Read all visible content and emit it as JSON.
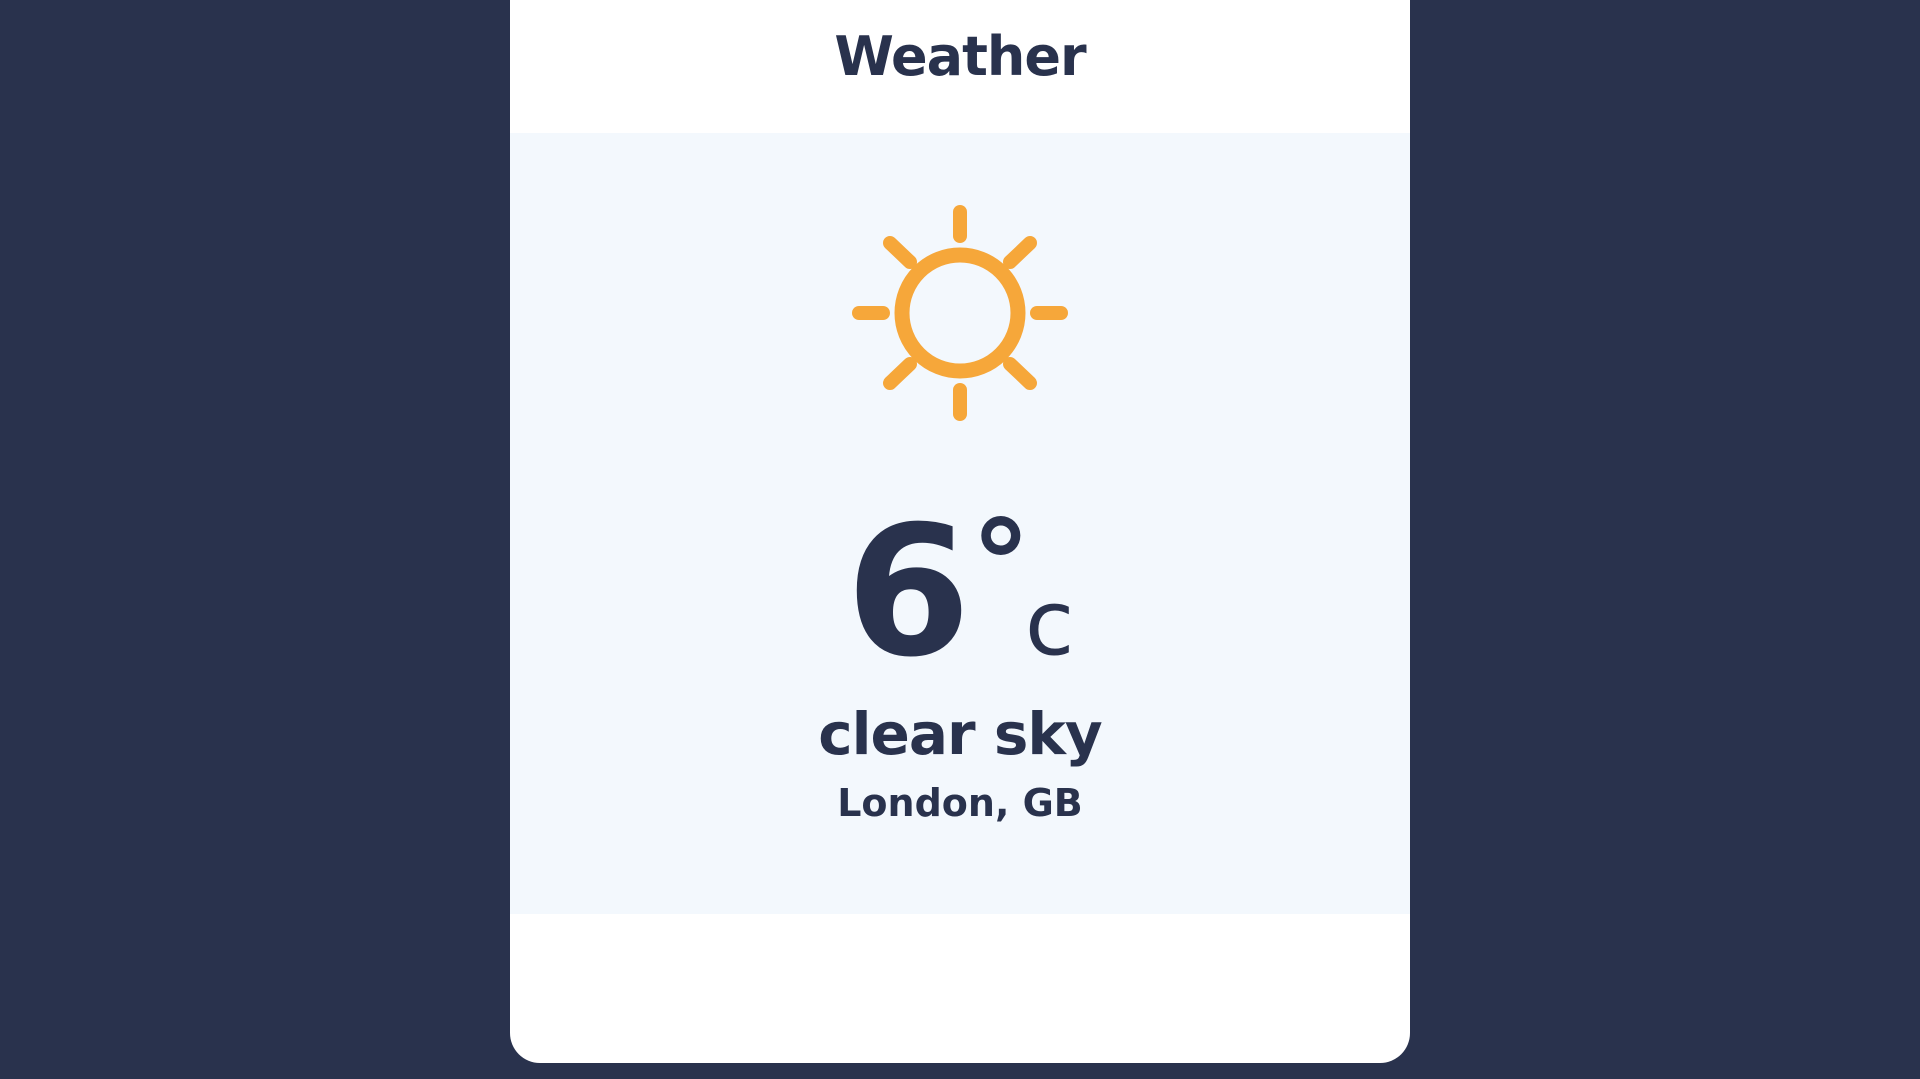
{
  "app": {
    "title": "Weather"
  },
  "weather": {
    "icon": "sun-icon",
    "temperature": "6",
    "degree_symbol": "°",
    "unit": "c",
    "description": "clear sky",
    "location": "London, GB"
  },
  "colors": {
    "background": "#29324d",
    "card": "#ffffff",
    "panel": "#f3f8fd",
    "text": "#29324d",
    "sun": "#f6a73a"
  }
}
